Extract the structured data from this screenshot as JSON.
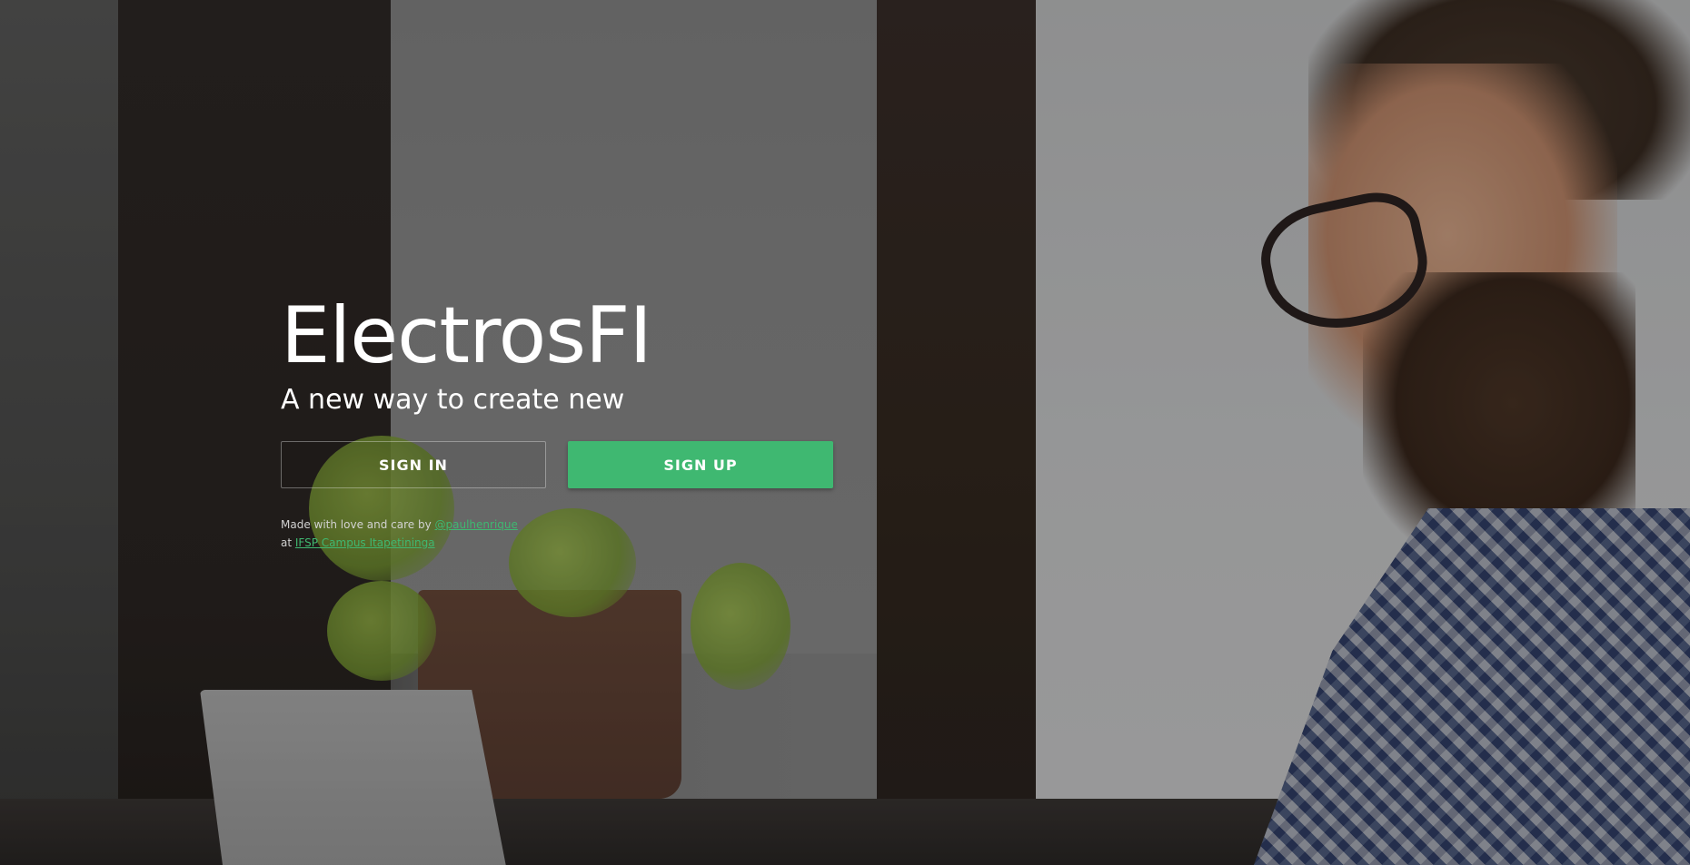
{
  "hero": {
    "title": "ElectrosFI",
    "tagline": "A new way to create new"
  },
  "actions": {
    "sign_in_label": "SIGN IN",
    "sign_up_label": "SIGN UP"
  },
  "credits": {
    "line1_prefix": "Made with love and care by ",
    "author_link": "@paulhenrique",
    "line2_prefix": "at ",
    "campus_link": "IFSP Campus Itapetininga"
  },
  "colors": {
    "accent": "#3fb871",
    "text": "#ffffff"
  }
}
